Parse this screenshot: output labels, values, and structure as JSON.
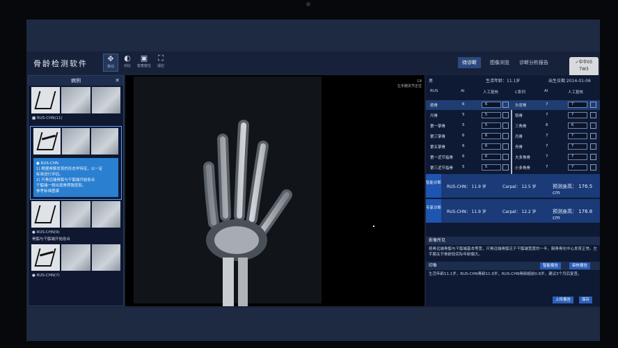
{
  "app": {
    "title": "骨龄检测软件"
  },
  "toolbar": {
    "tools": [
      {
        "icon": "move-icon",
        "glyph": "✥",
        "label": "移动"
      },
      {
        "icon": "contrast-icon",
        "glyph": "◐",
        "label": "对比"
      },
      {
        "icon": "window-icon",
        "glyph": "▣",
        "label": "窗宽窗位"
      },
      {
        "icon": "fit-icon",
        "glyph": "⛶",
        "label": "适应"
      }
    ],
    "tabs": [
      "待诊断",
      "图像浏览",
      "诊断分析报告"
    ],
    "lang": [
      "✓中华05",
      "TW3"
    ]
  },
  "left_panel": {
    "title": "病例",
    "cases": [
      {
        "label": "■ RUS-CHN(11)"
      },
      {
        "label": "● RUS-CHN(9)"
      },
      {
        "label": "● RUS-CHN(7)"
      }
    ],
    "info_lines": [
      "● RUS-CHN",
      "1) 根据骨骼发育的形态学特征，以一定",
      "  标准进行评估。",
      "2) 尺骨远端骨骺与干骺端开始愈合",
      "  干骺端一侧出现骨质致密影。",
      "  参考标准图谱"
    ],
    "note": "骨骺与干骺端开始愈合"
  },
  "viewer": {
    "overlay": [
      "C4",
      "左手腕关节正位"
    ]
  },
  "right_panel": {
    "sex_label": "男",
    "age_label": "生活年龄：11.1岁",
    "birth_label": "出生日期 2014-01-06",
    "head_left": [
      "RUS",
      "AI",
      "人工复核"
    ],
    "head_right": [
      "C系列",
      "AI",
      "人工复核"
    ],
    "rows": [
      {
        "name": "桡骨",
        "ai": "6",
        "val": "6",
        "name2": "头状骨",
        "ai2": "7",
        "val2": "7"
      },
      {
        "name": "尺骨",
        "ai": "5",
        "val": "5",
        "name2": "钩骨",
        "ai2": "7",
        "val2": "7"
      },
      {
        "name": "第一掌骨",
        "ai": "5",
        "val": "5",
        "name2": "三角骨",
        "ai2": "6",
        "val2": "6"
      },
      {
        "name": "第三掌骨",
        "ai": "6",
        "val": "6",
        "name2": "月骨",
        "ai2": "7",
        "val2": "7"
      },
      {
        "name": "第五掌骨",
        "ai": "6",
        "val": "6",
        "name2": "舟骨",
        "ai2": "7",
        "val2": "7"
      },
      {
        "name": "第一近节指骨",
        "ai": "6",
        "val": "6",
        "name2": "大多角骨",
        "ai2": "7",
        "val2": "7"
      },
      {
        "name": "第三近节指骨",
        "ai": "5",
        "val": "5",
        "name2": "小多角骨",
        "ai2": "7",
        "val2": "7"
      }
    ],
    "result1": {
      "label": "智能诊断",
      "rus": "RUS-CHN： 11.9 岁",
      "carpal": "Carpal： 12.5 岁",
      "height": "预测身高： 176.5 cm"
    },
    "result2": {
      "label": "专家诊断",
      "rus": "RUS-CHN： 11.9 岁",
      "carpal": "Carpal： 12.2 岁",
      "height": "预测身高： 176.8 cm"
    },
    "image_section": {
      "title": "影像所见",
      "text": "桡骨远端骨骺与干骺端基本等宽，尺骨远端骨骺见于干骺端宽度的一半，腕骨骨化中心发育正常。左手腕关节骨龄较实际年龄偏大。"
    },
    "advice_section": {
      "title": "印象",
      "btn1": "智能报告",
      "btn2": "审核报告",
      "text": "生活年龄11.1岁，RUS-CHN骨龄11.9岁，RUS-CHN骨龄超前0.8岁，建议3个月后复查。"
    },
    "footer": {
      "btn1": "上传报告",
      "btn2": "保存"
    }
  }
}
